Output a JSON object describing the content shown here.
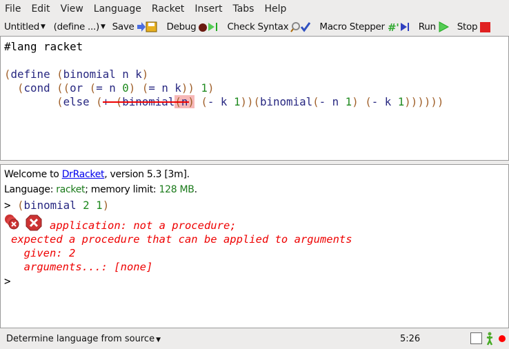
{
  "menu": [
    "File",
    "Edit",
    "View",
    "Language",
    "Racket",
    "Insert",
    "Tabs",
    "Help"
  ],
  "toolbar": {
    "file": "Untitled",
    "define": "(define ...)",
    "save": "Save",
    "debug": "Debug",
    "check_syntax": "Check Syntax",
    "macro_stepper": "Macro Stepper",
    "run": "Run",
    "stop": "Stop"
  },
  "editor": {
    "lines": [
      [
        {
          "t": "#lang racket",
          "c": "k"
        }
      ],
      [],
      [
        {
          "t": "(",
          "c": "p"
        },
        {
          "t": "define",
          "c": "i"
        },
        {
          "t": " ",
          "c": "k"
        },
        {
          "t": "(",
          "c": "p"
        },
        {
          "t": "binomial n k",
          "c": "i"
        },
        {
          "t": ")",
          "c": "p"
        }
      ],
      [
        {
          "t": "  (",
          "c": "p"
        },
        {
          "t": "cond",
          "c": "i"
        },
        {
          "t": " ((",
          "c": "p"
        },
        {
          "t": "or",
          "c": "i"
        },
        {
          "t": " (",
          "c": "p"
        },
        {
          "t": "= n ",
          "c": "i"
        },
        {
          "t": "0",
          "c": "n"
        },
        {
          "t": ") (",
          "c": "p"
        },
        {
          "t": "= n k",
          "c": "i"
        },
        {
          "t": ")) ",
          "c": "p"
        },
        {
          "t": "1",
          "c": "n"
        },
        {
          "t": ")",
          "c": "p"
        }
      ],
      [
        {
          "t": "        (",
          "c": "p"
        },
        {
          "t": "else",
          "c": "i"
        },
        {
          "t": " (",
          "c": "p"
        },
        {
          "t": "+",
          "c": "i"
        },
        {
          "t": " (",
          "c": "p"
        },
        {
          "t": "binomial",
          "c": "i"
        },
        {
          "t": "(",
          "c": "p hl"
        },
        {
          "t": "n",
          "c": "i hl"
        },
        {
          "t": ")",
          "c": "p hl"
        },
        {
          "t": " (",
          "c": "p"
        },
        {
          "t": "- k ",
          "c": "i"
        },
        {
          "t": "1",
          "c": "n"
        },
        {
          "t": "))(",
          "c": "p"
        },
        {
          "t": "binomial",
          "c": "i"
        },
        {
          "t": "(",
          "c": "p"
        },
        {
          "t": "- n ",
          "c": "i"
        },
        {
          "t": "1",
          "c": "n"
        },
        {
          "t": ") (",
          "c": "p"
        },
        {
          "t": "- k ",
          "c": "i"
        },
        {
          "t": "1",
          "c": "n"
        },
        {
          "t": "))))))",
          "c": "p"
        }
      ]
    ]
  },
  "repl": {
    "welcome_prefix": "Welcome to ",
    "welcome_link": "DrRacket",
    "welcome_suffix": ", version 5.3 [3m].",
    "lang_prefix": "Language: ",
    "lang": "racket",
    "lang_mid": "; memory limit: ",
    "mem": "128 MB",
    "lang_end": ".",
    "prompt": ">",
    "input_open": "(",
    "input_fn": "binomial",
    "input_args": "2 1",
    "input_close": ")",
    "error": [
      "application: not a procedure;",
      "expected a procedure that can be applied to arguments",
      "  given: 2",
      "  arguments...: [none]"
    ],
    "prompt2": ">"
  },
  "status": {
    "language": "Determine language from source",
    "position": "5:26"
  }
}
